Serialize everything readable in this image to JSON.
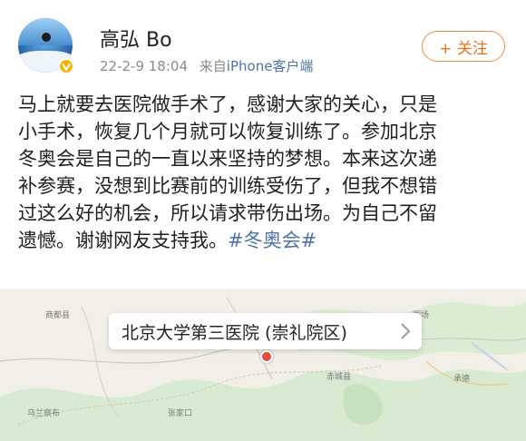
{
  "user": {
    "name": "高弘 Bo",
    "date": "22-2-9 18:04",
    "source_prefix": "来自",
    "source": "iPhone客户端",
    "follow_label": "+ 关注",
    "avatar": "avatar-skier-photo",
    "badge_icon": "verified-badge-icon"
  },
  "post": {
    "lines": [
      "马上就要去医院做手术了，感谢大家的关心，只是",
      "小手术，恢复几个月就可以恢复训练了。参加北京",
      "冬奥会是自己的一直以来坚持的梦想。本来这次递",
      "补参赛，没想到比赛前的训练受伤了，但我不想错",
      "过这么好的机会，所以请求带伤出场。为自己不留"
    ],
    "last_line": "遗憾。谢谢网友支持我。",
    "hashtag": "#冬奥会#"
  },
  "location": {
    "name": "北京大学第三医院 (崇礼院区)",
    "chevron_icon": "chevron-right-icon",
    "pin_icon": "map-pin-icon"
  },
  "colors": {
    "accent_orange": "#e9731a",
    "link_blue": "#4d74a8",
    "meta_gray": "#8a8a8a"
  }
}
